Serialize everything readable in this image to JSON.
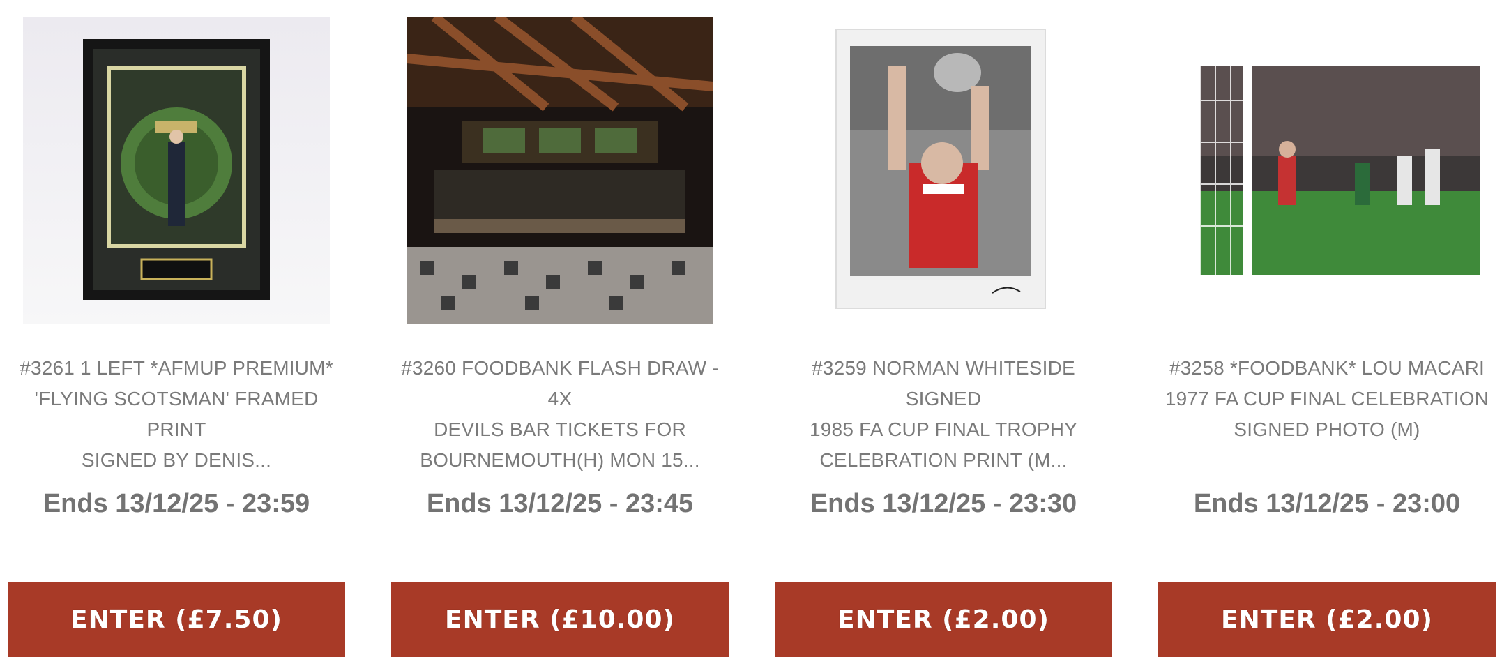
{
  "listings": [
    {
      "title": "#3261 1 LEFT *AFMUP PREMIUM*\n'FLYING SCOTSMAN' FRAMED PRINT\nSIGNED BY DENIS...",
      "ends": "Ends 13/12/25 - 23:59",
      "enter_label": "ENTER (£7.50)",
      "image": "framed-print-image"
    },
    {
      "title": "#3260 FOODBANK FLASH DRAW - 4X\nDEVILS BAR TICKETS FOR\nBOURNEMOUTH(H) MON 15...",
      "ends": "Ends 13/12/25 - 23:45",
      "enter_label": "ENTER (£10.00)",
      "image": "bar-interior-image"
    },
    {
      "title": "#3259 NORMAN WHITESIDE SIGNED\n1985 FA CUP FINAL TROPHY\nCELEBRATION PRINT (M...",
      "ends": "Ends 13/12/25 - 23:30",
      "enter_label": "ENTER (£2.00)",
      "image": "signed-print-image"
    },
    {
      "title": "#3258 *FOODBANK* LOU MACARI\n1977 FA CUP FINAL CELEBRATION\nSIGNED PHOTO (M)",
      "ends": "Ends 13/12/25 - 23:00",
      "enter_label": "ENTER (£2.00)",
      "image": "signed-photo-image"
    }
  ],
  "colors": {
    "button_bg": "#a83a27",
    "button_text": "#ffffff",
    "title_text": "#7a7a7a",
    "ends_text": "#737373"
  }
}
